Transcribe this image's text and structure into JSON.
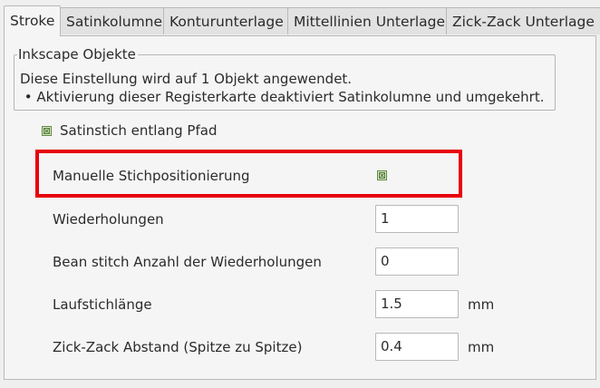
{
  "tabs": [
    {
      "label": "Stroke",
      "active": true
    },
    {
      "label": "Satinkolumne",
      "active": false
    },
    {
      "label": "Konturunterlage",
      "active": false
    },
    {
      "label": "Mittellinien Unterlage",
      "active": false
    },
    {
      "label": "Zick-Zack Unterlage",
      "active": false
    }
  ],
  "group": {
    "title": "Inkscape Objekte",
    "line1": "Diese Einstellung wird auf 1 Objekt angewendet.",
    "line2": " • Aktivierung dieser Registerkarte deaktiviert Satinkolumne und umgekehrt."
  },
  "satin_along_path": {
    "label": "Satinstich entlang Pfad",
    "checked": true
  },
  "manual_stitch": {
    "label": "Manuelle Stichpositionierung",
    "checked": true
  },
  "fields": [
    {
      "label": "Wiederholungen",
      "value": "1",
      "unit": ""
    },
    {
      "label": "Bean stitch Anzahl der Wiederholungen",
      "value": "0",
      "unit": ""
    },
    {
      "label": "Laufstichlänge",
      "value": "1.5",
      "unit": "mm"
    },
    {
      "label": "Zick-Zack Abstand (Spitze zu Spitze)",
      "value": "0.4",
      "unit": "mm"
    }
  ],
  "colors": {
    "highlight": "#e8000b",
    "checkbox": "#5e8a3e"
  }
}
